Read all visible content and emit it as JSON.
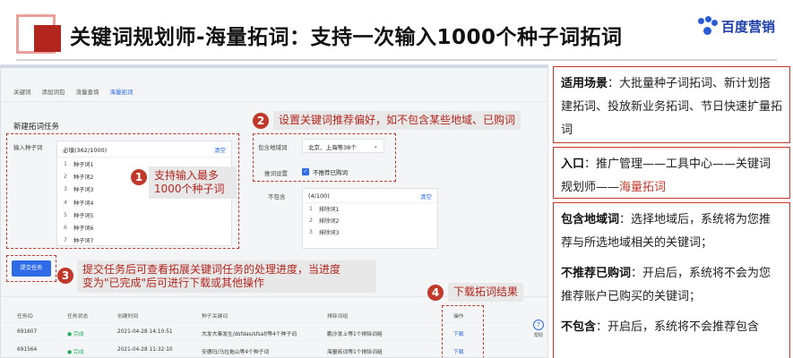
{
  "header": {
    "title": "关键词规划师-海量拓词：支持一次输入1000个种子词拓词",
    "brand": "百度营销",
    "brand_color": "#1f3fa8",
    "accent_color": "#b3261e"
  },
  "app": {
    "tabs": [
      "关键词",
      "添加词包",
      "流量查询",
      "海量拓词"
    ],
    "active_tab": "海量拓词",
    "section_title": "新建拓词任务",
    "seed_label": "输入种子词",
    "seed_required": "必填(362/1000)",
    "seed_clear": "清空",
    "seed_words": [
      {
        "n": "1",
        "w": "种子词1"
      },
      {
        "n": "2",
        "w": "种子词2"
      },
      {
        "n": "3",
        "w": "种子词3"
      },
      {
        "n": "4",
        "w": "种子词4"
      },
      {
        "n": "5",
        "w": "种子词5"
      },
      {
        "n": "6",
        "w": "种子词6"
      },
      {
        "n": "7",
        "w": "种子词7"
      }
    ],
    "region_label": "包含地域词",
    "region_value": "北京、上海等38个",
    "recommend_label": "推词设置",
    "recommend_check": "不推荐已购词",
    "exclude_label": "不包含",
    "exclude_count": "(4/100)",
    "exclude_clear": "清空",
    "exclude_words": [
      {
        "n": "1",
        "w": "排除词1"
      },
      {
        "n": "2",
        "w": "排除词2"
      },
      {
        "n": "3",
        "w": "排除词3"
      }
    ],
    "submit_label": "提交任务",
    "table": {
      "headers": [
        "任务ID",
        "任务状态",
        "创建时间",
        "种子关键词",
        "排除词组",
        "操作"
      ],
      "rows": [
        {
          "id": "691607",
          "status": "● 完成",
          "time": "2021-04-28 14:10:51",
          "seed": "大发大事发生/dsfdas/sfsaf/等4个种子词",
          "exclude": "鹏沙发上等1个排除词组",
          "op": "下载"
        },
        {
          "id": "691564",
          "status": "● 完成",
          "time": "2021-04-28 11:32:10",
          "seed": "安德玛/马拉拖山等4个种子词",
          "exclude": "海量拓词等1个排除词组",
          "op": "下载"
        }
      ]
    },
    "help_label": "帮助",
    "help_icon": "?"
  },
  "callouts": {
    "c1_num": "1",
    "c1_line1": "支持输入最多",
    "c1_line2": "1000个种子词",
    "c2_num": "2",
    "c2_text": "设置关键词推荐偏好，如不包含某些地域、已购词",
    "c3_num": "3",
    "c3_line1": "提交任务后可查看拓展关键词任务的处理进度，当进度",
    "c3_line2": "变为\"已完成\"后可进行下载或其他操作",
    "c4_num": "4",
    "c4_text": "下载拓词结果"
  },
  "notes": {
    "n1_bold": "适用场景",
    "n1_text": "：大批量种子词拓词、新计划搭建拓词、投放新业务拓词、节日快速扩量拓词",
    "n2_bold": "入口",
    "n2_text": "：推广管理——工具中心——关键词规划师——",
    "n2_hl": "海量拓词",
    "n3_bold": "包含地域词",
    "n3_text": "：选择地域后，系统将为您推荐与所选地域相关的关键词；",
    "n4_bold": "不推荐已购词",
    "n4_text": "：开启后，系统将不会为您推荐账户已购买的关键词；",
    "n5_bold": "不包含",
    "n5_text": "：开启后，系统将不会推荐包含"
  }
}
